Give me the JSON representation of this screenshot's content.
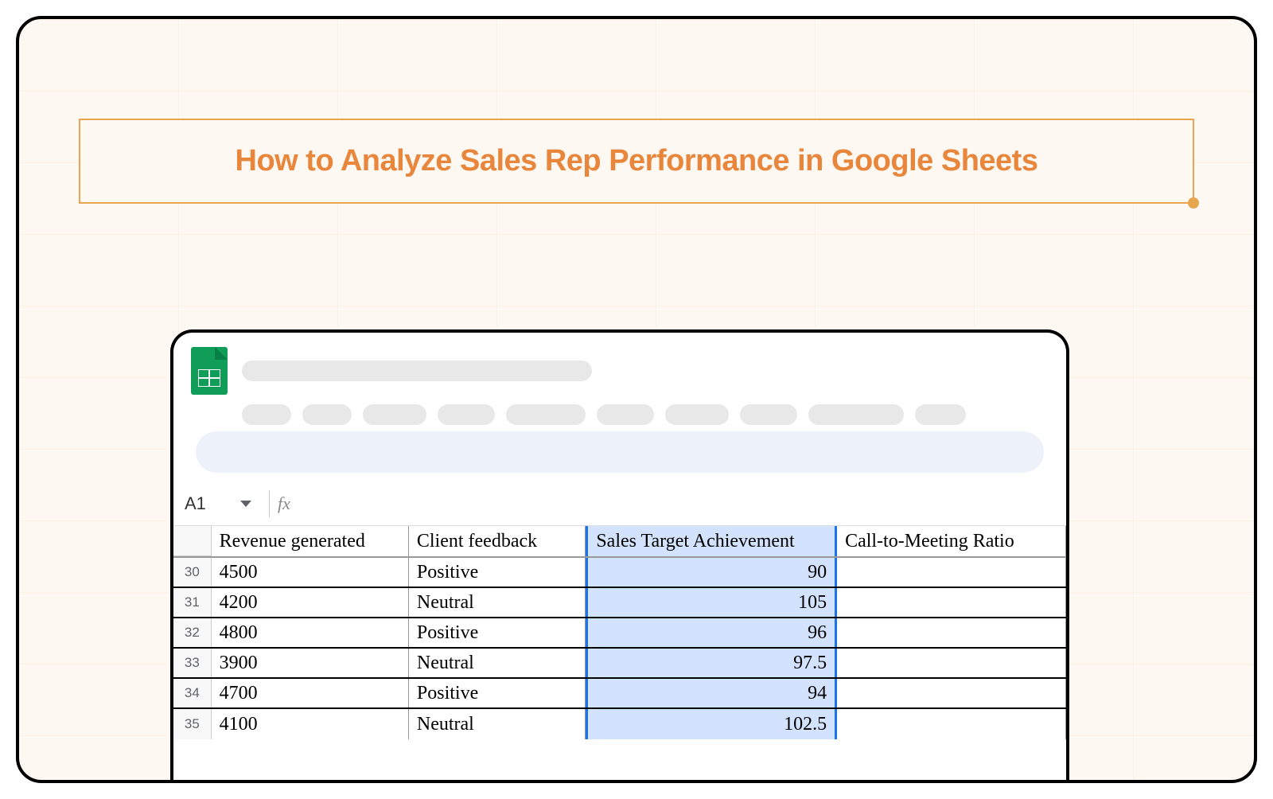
{
  "title": "How to Analyze Sales Rep Performance in Google Sheets",
  "formula_bar": {
    "cell_ref": "A1",
    "fx_label": "fx"
  },
  "columns": [
    {
      "label": "Revenue generated",
      "selected": false
    },
    {
      "label": "Client feedback",
      "selected": false
    },
    {
      "label": "Sales Target Achievement",
      "selected": true
    },
    {
      "label": "Call-to-Meeting Ratio",
      "selected": false
    }
  ],
  "rows": [
    {
      "num": "30",
      "revenue": "4500",
      "feedback": "Positive",
      "target": "90",
      "ratio": ""
    },
    {
      "num": "31",
      "revenue": "4200",
      "feedback": "Neutral",
      "target": "105",
      "ratio": ""
    },
    {
      "num": "32",
      "revenue": "4800",
      "feedback": "Positive",
      "target": "96",
      "ratio": ""
    },
    {
      "num": "33",
      "revenue": "3900",
      "feedback": "Neutral",
      "target": "97.5",
      "ratio": ""
    },
    {
      "num": "34",
      "revenue": "4700",
      "feedback": "Positive",
      "target": "94",
      "ratio": ""
    },
    {
      "num": "35",
      "revenue": "4100",
      "feedback": "Neutral",
      "target": "102.5",
      "ratio": "",
      "partial": true
    }
  ],
  "menu_widths": [
    62,
    62,
    80,
    72,
    100,
    72,
    80,
    72,
    120,
    64
  ]
}
